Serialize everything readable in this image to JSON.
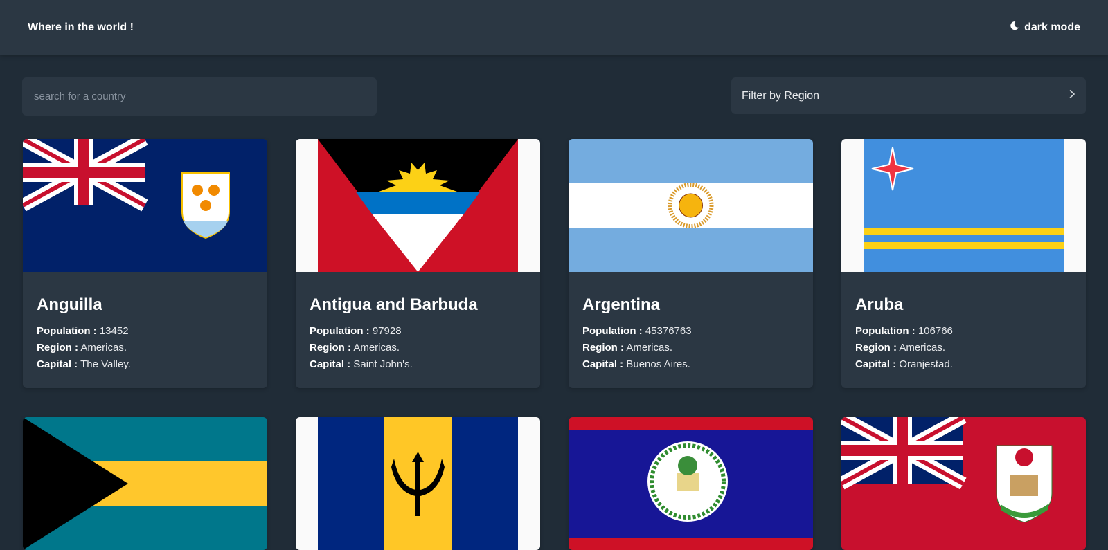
{
  "header": {
    "title": "Where in the world !",
    "theme_label": "dark mode",
    "theme_icon": "moon-icon"
  },
  "search": {
    "placeholder": "search for a country",
    "value": ""
  },
  "filter": {
    "label": "Filter by Region",
    "icon": "chevron-right-icon"
  },
  "field_labels": {
    "population": "Population :",
    "region": "Region :",
    "capital": "Capital :"
  },
  "countries": [
    {
      "name": "Anguilla",
      "population": "13452",
      "region": "Americas.",
      "capital": "The Valley."
    },
    {
      "name": "Antigua and Barbuda",
      "population": "97928",
      "region": "Americas.",
      "capital": "Saint John's."
    },
    {
      "name": "Argentina",
      "population": "45376763",
      "region": "Americas.",
      "capital": "Buenos Aires."
    },
    {
      "name": "Aruba",
      "population": "106766",
      "region": "Americas.",
      "capital": "Oranjestad."
    }
  ],
  "partial_cards": [
    "Bahamas flag",
    "Barbados flag",
    "Belize flag",
    "Bermuda flag"
  ],
  "colors": {
    "background": "#202c37",
    "surface": "#2b3743",
    "text": "#ffffff"
  }
}
